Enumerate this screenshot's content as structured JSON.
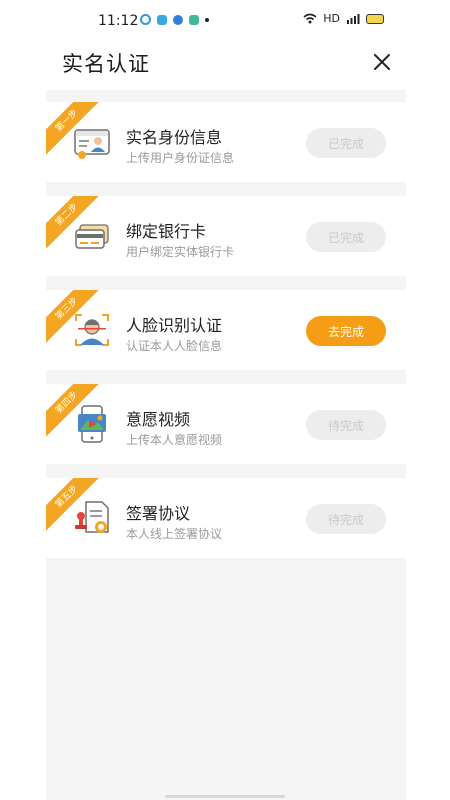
{
  "status_bar": {
    "time": "11:12",
    "network": "HD",
    "signal": "4G"
  },
  "header": {
    "title": "实名认证"
  },
  "steps": [
    {
      "badge": "第一步",
      "title": "实名身份信息",
      "desc": "上传用户身份证信息",
      "button": "已完成",
      "state": "done"
    },
    {
      "badge": "第二步",
      "title": "绑定银行卡",
      "desc": "用户绑定实体银行卡",
      "button": "已完成",
      "state": "done"
    },
    {
      "badge": "第三步",
      "title": "人脸识别认证",
      "desc": "认证本人人脸信息",
      "button": "去完成",
      "state": "active"
    },
    {
      "badge": "第四步",
      "title": "意愿视频",
      "desc": "上传本人意愿视频",
      "button": "待完成",
      "state": "pending"
    },
    {
      "badge": "第五步",
      "title": "签署协议",
      "desc": "本人线上签署协议",
      "button": "待完成",
      "state": "pending"
    }
  ],
  "colors": {
    "accent": "#f59d14",
    "ribbon": "#f4a623",
    "background": "#f5f5f5"
  }
}
